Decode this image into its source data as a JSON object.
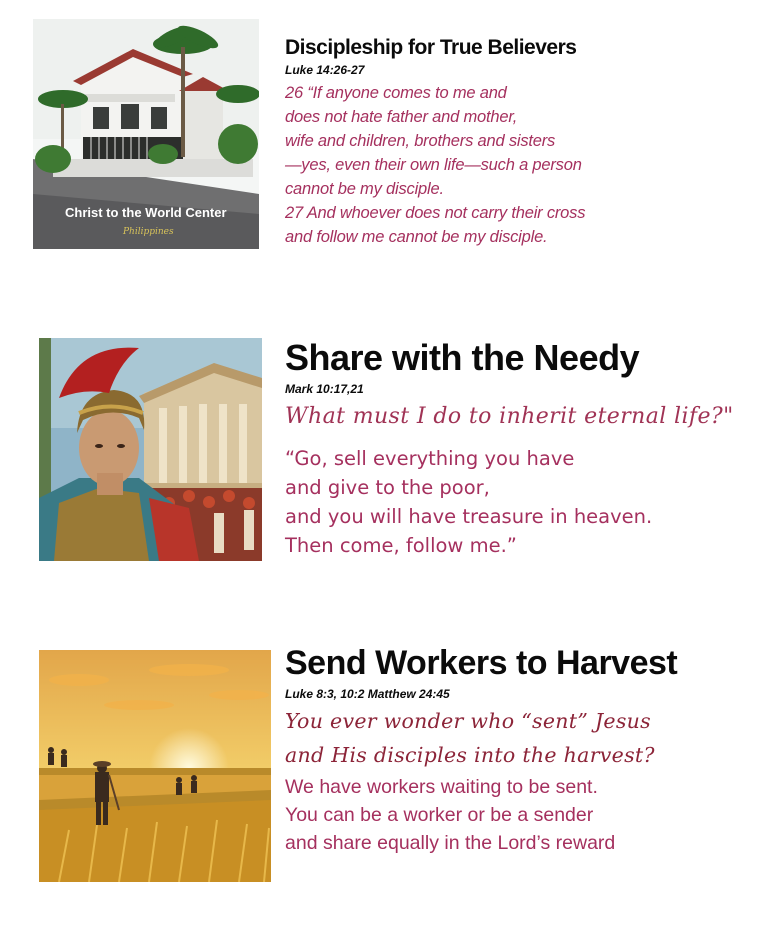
{
  "sections": [
    {
      "title": "Discipleship for True Believers",
      "reference": "Luke 14:26-27",
      "image_caption": "Christ to the World Center",
      "image_subcaption": "Philippines",
      "verse_lines": [
        "26 “If anyone comes to me and",
        "does not hate father and mother,",
        "wife and children, brothers and sisters",
        "—yes, even their own life—such a person",
        "cannot be my disciple.",
        "27 And whoever does not carry their cross",
        "and follow me cannot be my disciple."
      ]
    },
    {
      "title": "Share with the Needy",
      "reference": "Mark 10:17,21",
      "script_lines": [
        "What must I do to inherit eternal life?\""
      ],
      "verse_lines": [
        "“Go, sell everything you have",
        "and give to the poor,",
        "and you will have treasure in heaven.",
        "Then come, follow me.”"
      ]
    },
    {
      "title": "Send Workers to Harvest",
      "reference": "Luke 8:3, 10:2  Matthew 24:45",
      "script_lines": [
        "You ever wonder who “sent” Jesus",
        "and His disciples into the harvest?"
      ],
      "verse_lines": [
        "We have workers waiting to be sent.",
        "You can be a worker or be a sender",
        "and share equally in the Lord’s reward"
      ]
    }
  ],
  "colors": {
    "title": "#0b0b0b",
    "verse": "#a5305e",
    "script": "#a03355"
  }
}
